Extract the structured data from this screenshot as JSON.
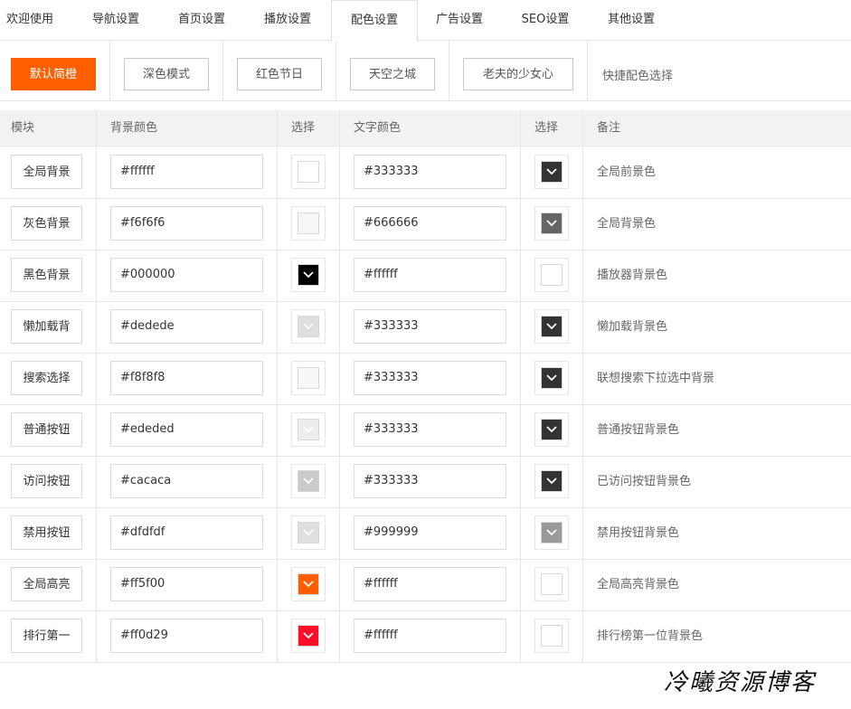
{
  "tabs": [
    {
      "label": "欢迎使用",
      "active": false
    },
    {
      "label": "导航设置",
      "active": false
    },
    {
      "label": "首页设置",
      "active": false
    },
    {
      "label": "播放设置",
      "active": false
    },
    {
      "label": "配色设置",
      "active": true
    },
    {
      "label": "广告设置",
      "active": false
    },
    {
      "label": "SEO设置",
      "active": false
    },
    {
      "label": "其他设置",
      "active": false
    }
  ],
  "presets": {
    "buttons": [
      "默认简橙",
      "深色模式",
      "红色节日",
      "天空之城",
      "老夫的少女心"
    ],
    "quick_label": "快捷配色选择",
    "accent_color": "#ff5f00"
  },
  "table": {
    "headers": [
      "模块",
      "背景颜色",
      "选择",
      "文字颜色",
      "选择",
      "备注"
    ],
    "rows": [
      {
        "module": "全局背景",
        "bg": "#ffffff",
        "fg": "#333333",
        "note": "全局前景色"
      },
      {
        "module": "灰色背景",
        "bg": "#f6f6f6",
        "fg": "#666666",
        "note": "全局背景色"
      },
      {
        "module": "黑色背景",
        "bg": "#000000",
        "fg": "#ffffff",
        "note": "播放器背景色"
      },
      {
        "module": "懒加载背",
        "bg": "#dedede",
        "fg": "#333333",
        "note": "懒加载背景色"
      },
      {
        "module": "搜索选择",
        "bg": "#f8f8f8",
        "fg": "#333333",
        "note": "联想搜索下拉选中背景"
      },
      {
        "module": "普通按钮",
        "bg": "#ededed",
        "fg": "#333333",
        "note": "普通按钮背景色"
      },
      {
        "module": "访问按钮",
        "bg": "#cacaca",
        "fg": "#333333",
        "note": "已访问按钮背景色"
      },
      {
        "module": "禁用按钮",
        "bg": "#dfdfdf",
        "fg": "#999999",
        "note": "禁用按钮背景色"
      },
      {
        "module": "全局高亮",
        "bg": "#ff5f00",
        "fg": "#ffffff",
        "note": "全局高亮背景色"
      },
      {
        "module": "排行第一",
        "bg": "#ff0d29",
        "fg": "#ffffff",
        "note": "排行榜第一位背景色"
      }
    ]
  },
  "watermark": "冷曦资源博客"
}
